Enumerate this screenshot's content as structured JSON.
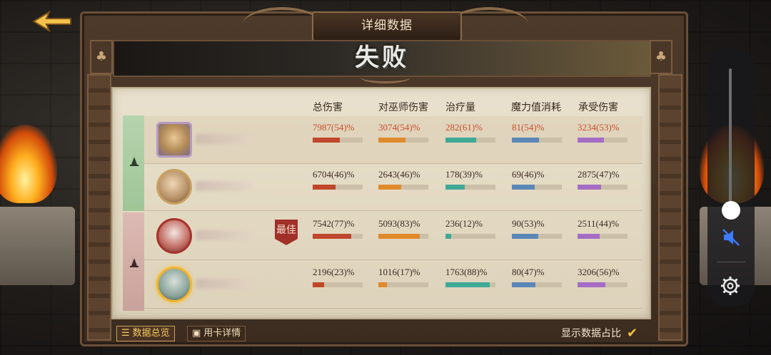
{
  "title": "详细数据",
  "result": "失败",
  "columns": [
    "总伤害",
    "对巫师伤害",
    "治疗量",
    "魔力值消耗",
    "承受伤害"
  ],
  "best_label": "最佳",
  "rows": [
    {
      "team": "green",
      "stats": [
        {
          "text": "7987(54)%",
          "value": 54
        },
        {
          "text": "3074(54)%",
          "value": 54
        },
        {
          "text": "282(61)%",
          "value": 61
        },
        {
          "text": "81(54)%",
          "value": 54
        },
        {
          "text": "3234(53)%",
          "value": 53
        }
      ]
    },
    {
      "team": "green",
      "stats": [
        {
          "text": "6704(46)%",
          "value": 46
        },
        {
          "text": "2643(46)%",
          "value": 46
        },
        {
          "text": "178(39)%",
          "value": 39
        },
        {
          "text": "69(46)%",
          "value": 46
        },
        {
          "text": "2875(47)%",
          "value": 47
        }
      ]
    },
    {
      "team": "red",
      "best": true,
      "stats": [
        {
          "text": "7542(77)%",
          "value": 77
        },
        {
          "text": "5093(83)%",
          "value": 83
        },
        {
          "text": "236(12)%",
          "value": 12
        },
        {
          "text": "90(53)%",
          "value": 53
        },
        {
          "text": "2511(44)%",
          "value": 44
        }
      ]
    },
    {
      "team": "red",
      "stats": [
        {
          "text": "2196(23)%",
          "value": 23
        },
        {
          "text": "1016(17)%",
          "value": 17
        },
        {
          "text": "1763(88)%",
          "value": 88
        },
        {
          "text": "80(47)%",
          "value": 47
        },
        {
          "text": "3206(56)%",
          "value": 56
        }
      ]
    }
  ],
  "bar_colors": [
    "#c0472b",
    "#e08a2c",
    "#3fa996",
    "#5b87b7",
    "#a56cc5"
  ],
  "tabs": [
    "数据总览",
    "用卡详情"
  ],
  "toggle_label": "显示数据占比",
  "icons": {
    "back": "back-arrow-icon",
    "team_green": "wizard-hat-icon",
    "team_red": "wizard-hat-icon",
    "mute": "speaker-muted-icon",
    "settings": "gear-icon"
  }
}
